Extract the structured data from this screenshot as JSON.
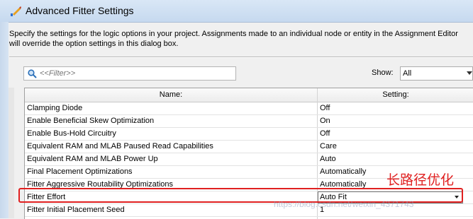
{
  "window": {
    "title": "Advanced Fitter Settings"
  },
  "description": "Specify the settings for the logic options in your project.  Assignments made to an individual node or entity in the Assignment Editor will override the option settings in this dialog box.",
  "filter": {
    "placeholder": "<<Filter>>",
    "icon": "search-icon"
  },
  "show": {
    "label": "Show:",
    "value": "All"
  },
  "table": {
    "columns": [
      "Name:",
      "Setting:"
    ],
    "rows": [
      {
        "name": "Clamping Diode",
        "setting": "Off"
      },
      {
        "name": "Enable Beneficial Skew Optimization",
        "setting": "On"
      },
      {
        "name": "Enable Bus-Hold Circuitry",
        "setting": "Off"
      },
      {
        "name": "Equivalent RAM and MLAB Paused Read Capabilities",
        "setting": "Care"
      },
      {
        "name": "Equivalent RAM and MLAB Power Up",
        "setting": "Auto"
      },
      {
        "name": "Final Placement Optimizations",
        "setting": "Automatically"
      },
      {
        "name": "Fitter Aggressive Routability Optimizations",
        "setting": "Automatically"
      },
      {
        "name": "Fitter Effort",
        "setting": "Auto Fit"
      },
      {
        "name": "Fitter Initial Placement Seed",
        "setting": "1"
      }
    ]
  },
  "annotation": {
    "text": "长路径优化",
    "color": "#e02020"
  },
  "watermark": "https://blog.csdn.net/weixin_4371743"
}
